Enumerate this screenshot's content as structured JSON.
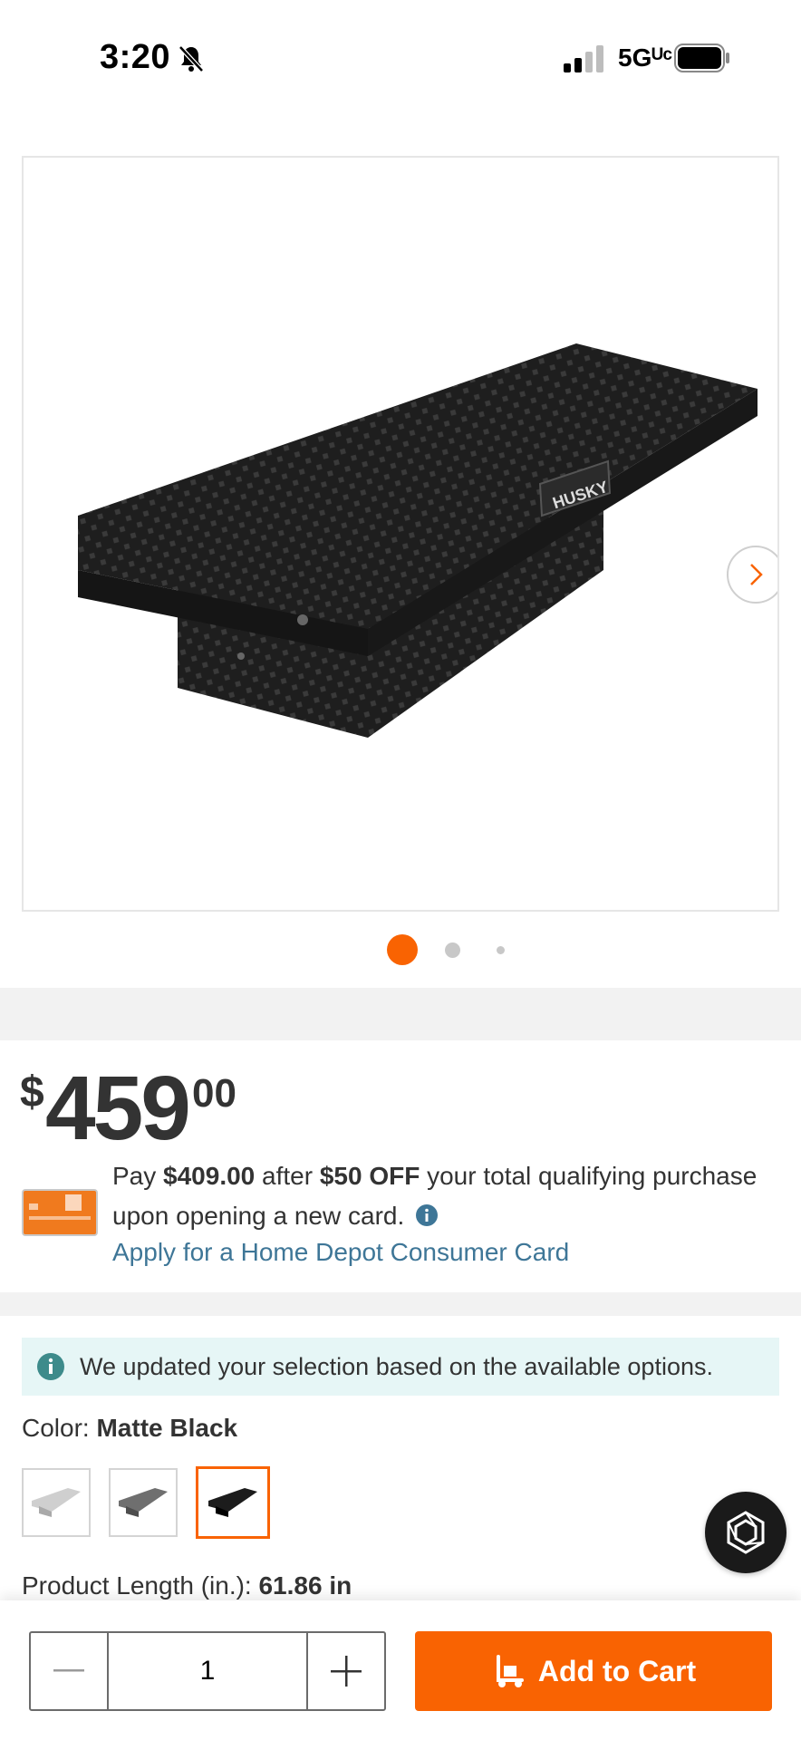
{
  "status_bar": {
    "time": "3:20",
    "network": "5Gᵁᶜ"
  },
  "gallery": {
    "image_alt": "Matte Black truck tool box",
    "brand_plate": "HUSKY",
    "active_dot": 1,
    "dot_count": 3
  },
  "price": {
    "currency": "$",
    "dollars": "459",
    "cents": "00"
  },
  "promo": {
    "pay": "Pay",
    "amount": "$409.00",
    "after": "after",
    "discount": "$50 OFF",
    "rest": "your total qualifying purchase upon opening a new card.",
    "apply_link": "Apply for a Home Depot Consumer Card"
  },
  "notice": {
    "text": "We updated your selection based on the available options."
  },
  "color": {
    "label": "Color:",
    "value": "Matte Black",
    "swatches": [
      "Silver",
      "Gray",
      "Matte Black"
    ],
    "selected_index": 2
  },
  "product_length": {
    "label": "Product Length (in.):",
    "value": "61.86 in"
  },
  "cart": {
    "quantity": "1",
    "add_label": "Add to Cart"
  },
  "colors": {
    "brand_orange": "#f96302",
    "link_blue": "#3e7697",
    "info_teal": "#3d8b8b",
    "notice_bg": "#e6f6f6"
  }
}
